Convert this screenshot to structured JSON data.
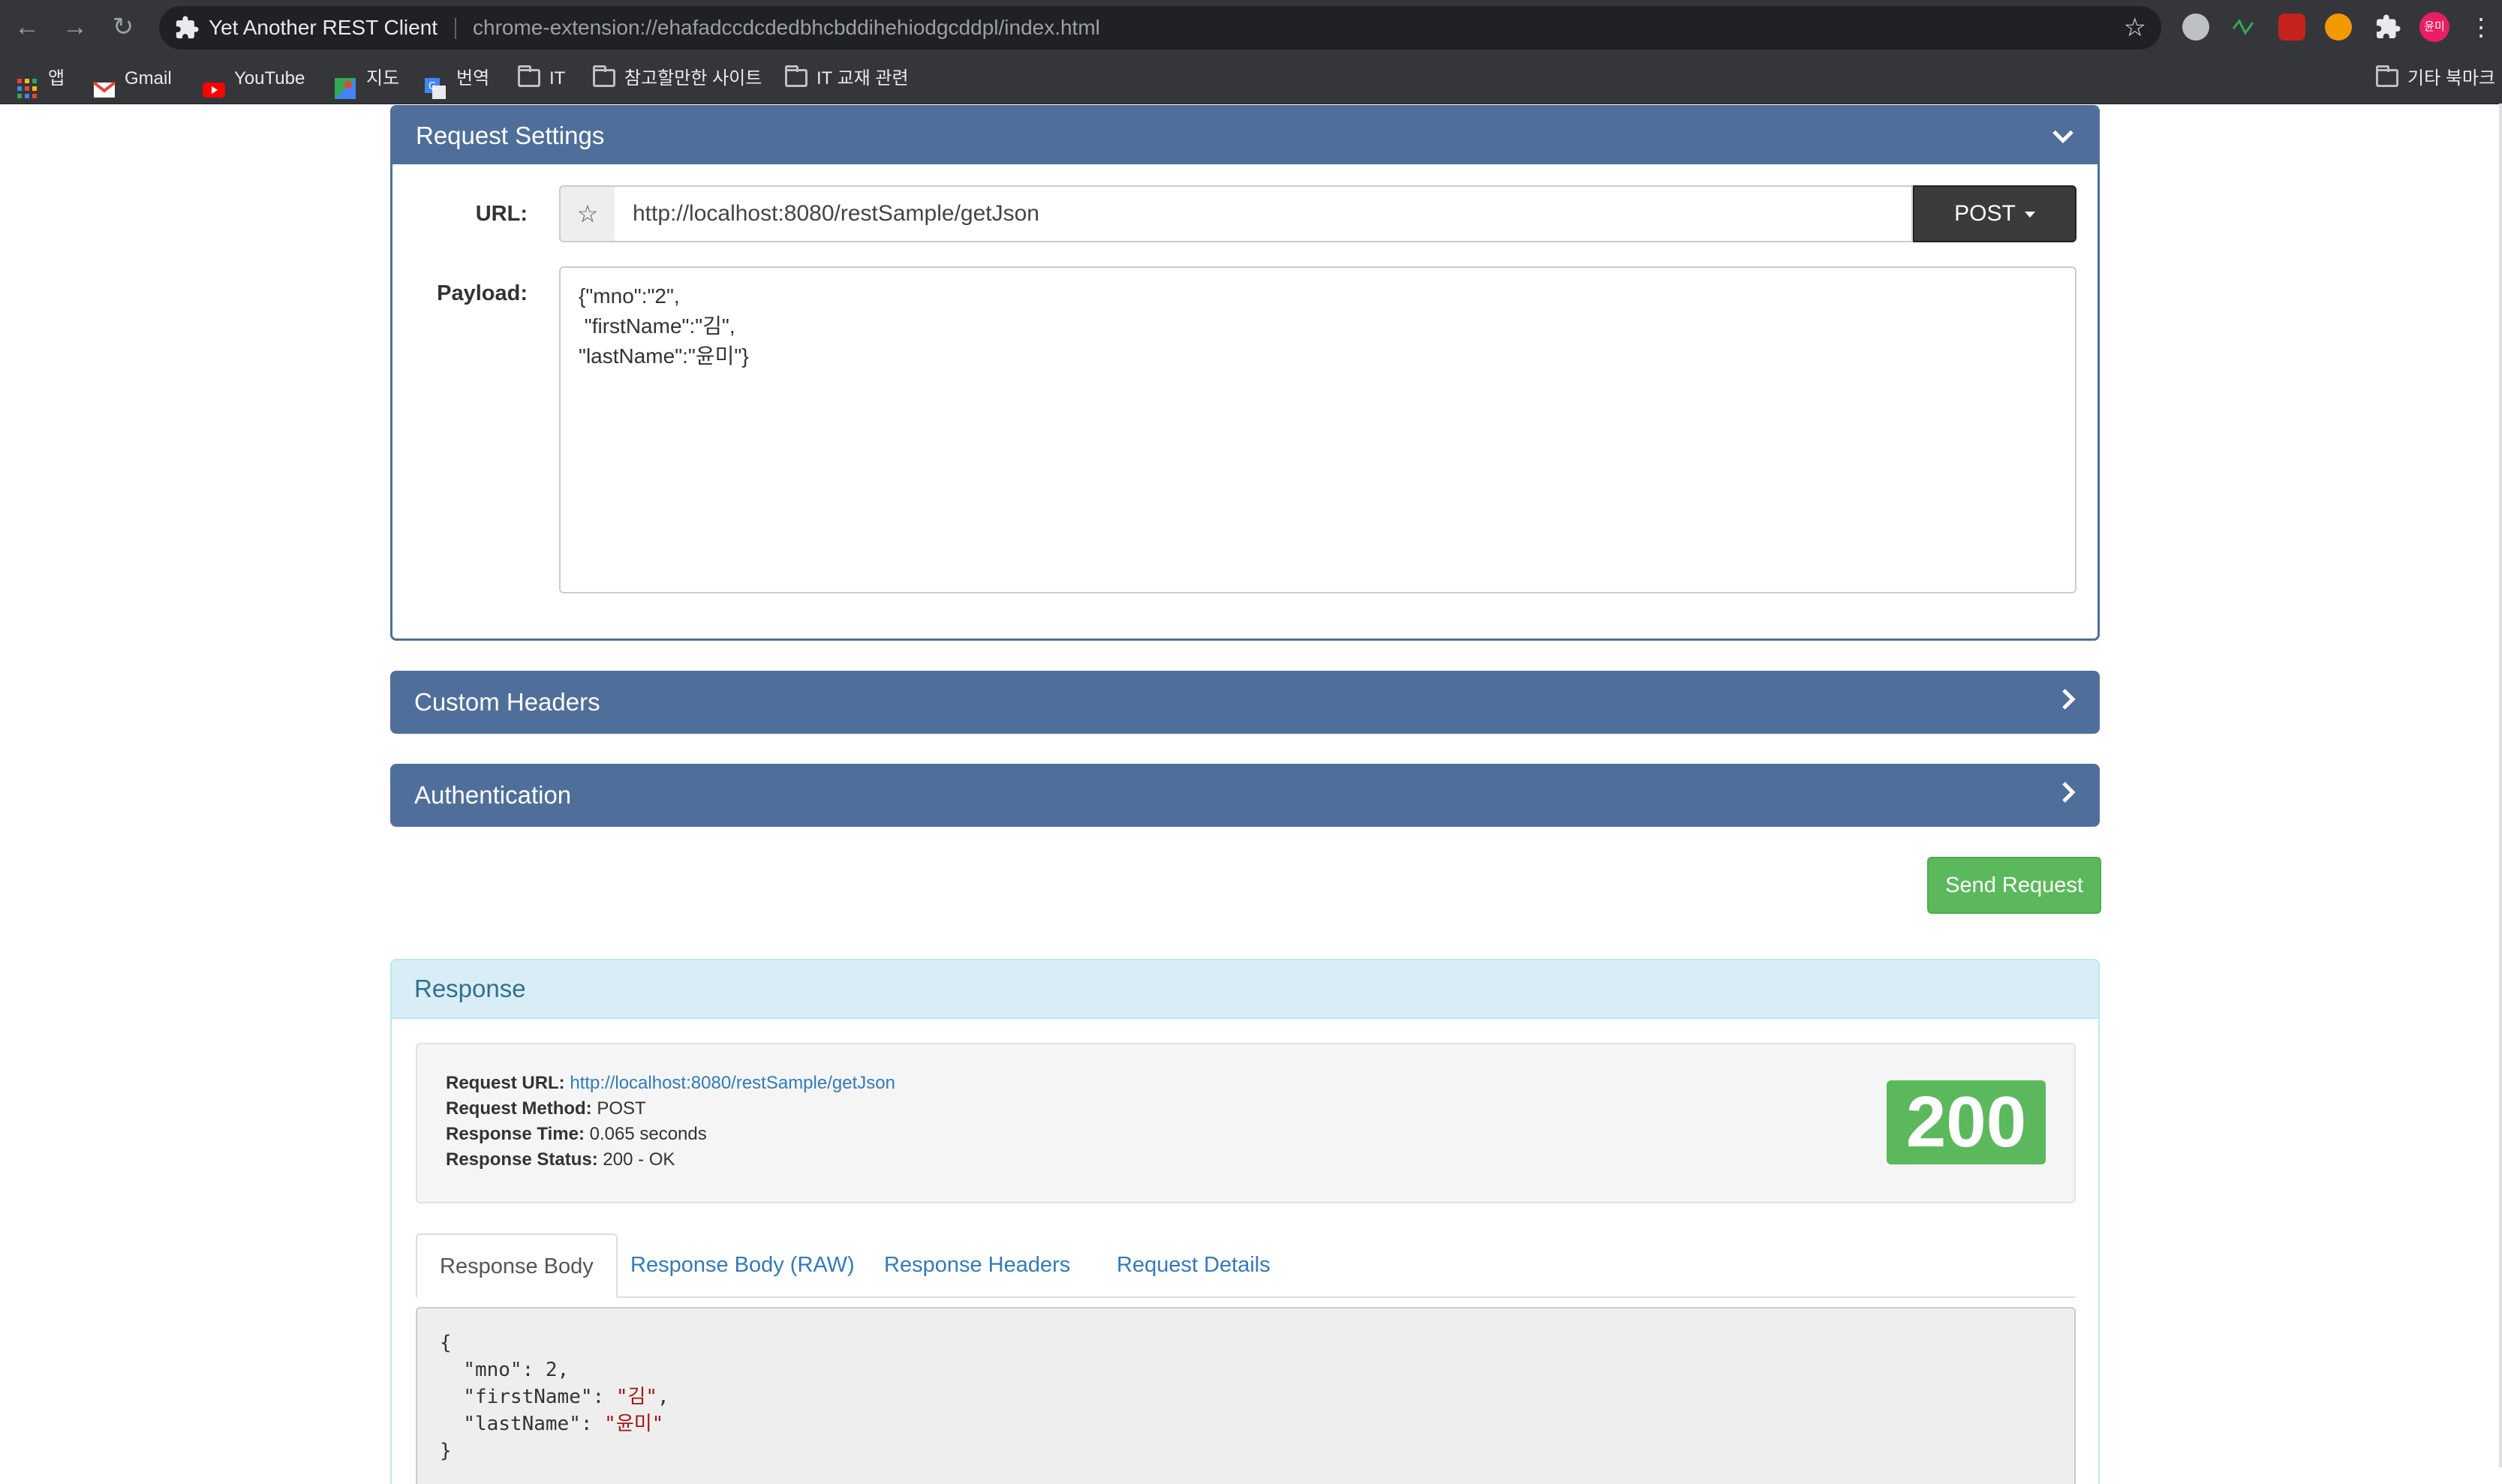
{
  "browser": {
    "tab_title": "Yet Another REST Client",
    "address": "chrome-extension://ehafadccdcdedbhcbddihehiodgcddpl/index.html",
    "profile_initials": "윤미"
  },
  "bookmarks": {
    "apps": "앱",
    "items": [
      "Gmail",
      "YouTube",
      "지도",
      "번역",
      "IT",
      "참고할만한 사이트",
      "IT 교재 관련"
    ],
    "other": "기타 북마크"
  },
  "request_settings": {
    "title": "Request Settings",
    "url_label": "URL:",
    "url_value": "http://localhost:8080/restSample/getJson",
    "method": "POST",
    "payload_label": "Payload:",
    "payload": "{\"mno\":\"2\",\n \"firstName\":\"김\",\n\"lastName\":\"윤미\"}"
  },
  "custom_headers": {
    "title": "Custom Headers"
  },
  "authentication": {
    "title": "Authentication"
  },
  "send_button": "Send Request",
  "response": {
    "title": "Response",
    "request_url_label": "Request URL:",
    "request_url": "http://localhost:8080/restSample/getJson",
    "request_method_label": "Request Method:",
    "request_method": "POST",
    "response_time_label": "Response Time:",
    "response_time": "0.065 seconds",
    "response_status_label": "Response Status:",
    "response_status": "200 - OK",
    "status_code": "200",
    "tabs": [
      "Response Body",
      "Response Body (RAW)",
      "Response Headers",
      "Request Details"
    ],
    "body": {
      "open": "{",
      "line1_key": "\"mno\"",
      "line1_val": "2",
      "line2_key": "\"firstName\"",
      "line2_val": "\"김\"",
      "line3_key": "\"lastName\"",
      "line3_val": "\"윤미\"",
      "close": "}"
    }
  },
  "colors": {
    "panel_header": "#4f6f9a",
    "send_button": "#5cb85c",
    "status_badge": "#5cb85c",
    "response_header_bg": "#d9edf7",
    "link": "#337ab7"
  }
}
